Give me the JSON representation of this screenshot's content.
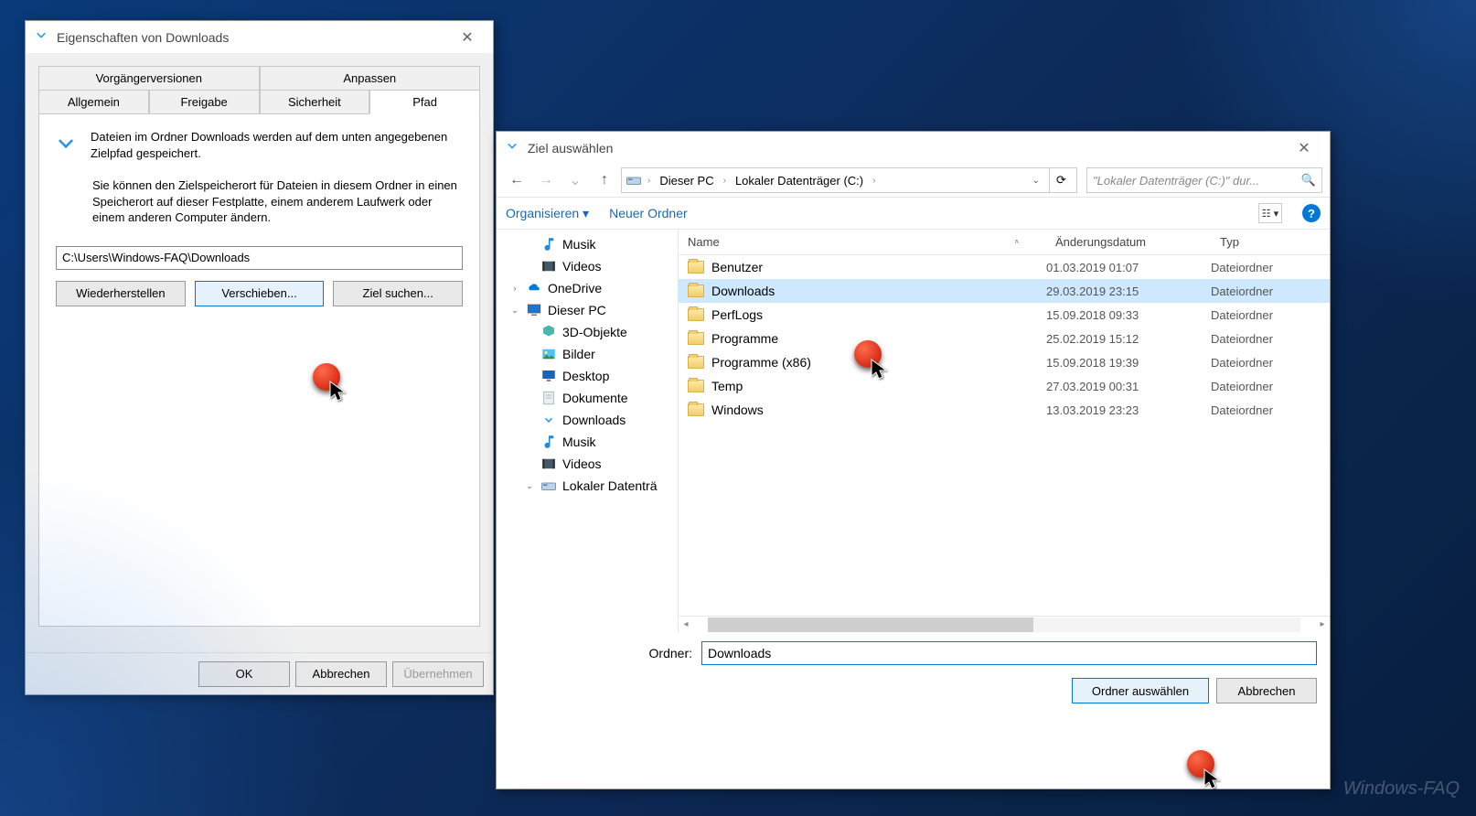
{
  "props": {
    "title": "Eigenschaften von Downloads",
    "tabs_row1": [
      "Vorgängerversionen",
      "Anpassen"
    ],
    "tabs_row2": [
      "Allgemein",
      "Freigabe",
      "Sicherheit",
      "Pfad"
    ],
    "active_tab": "Pfad",
    "info_line": "Dateien im Ordner Downloads werden auf dem unten angegebenen Zielpfad gespeichert.",
    "para": "Sie können den Zielspeicherort für Dateien in diesem Ordner in einen Speicherort auf dieser Festplatte, einem anderem Laufwerk oder einem anderen Computer ändern.",
    "path_value": "C:\\Users\\Windows-FAQ\\Downloads",
    "btn_restore": "Wiederherstellen",
    "btn_move": "Verschieben...",
    "btn_find": "Ziel suchen...",
    "btn_ok": "OK",
    "btn_cancel": "Abbrechen",
    "btn_apply": "Übernehmen"
  },
  "picker": {
    "title": "Ziel auswählen",
    "breadcrumb": [
      "Dieser PC",
      "Lokaler Datenträger (C:)"
    ],
    "search_placeholder": "\"Lokaler Datenträger (C:)\" dur...",
    "cmd_organize": "Organisieren",
    "cmd_newfolder": "Neuer Ordner",
    "tree": [
      {
        "label": "Musik",
        "icon": "music",
        "indent": 1
      },
      {
        "label": "Videos",
        "icon": "video",
        "indent": 1
      },
      {
        "label": "OneDrive",
        "icon": "onedrive",
        "indent": 0,
        "exp": ">"
      },
      {
        "label": "Dieser PC",
        "icon": "pc",
        "indent": 0,
        "exp": "v"
      },
      {
        "label": "3D-Objekte",
        "icon": "3d",
        "indent": 1
      },
      {
        "label": "Bilder",
        "icon": "pictures",
        "indent": 1
      },
      {
        "label": "Desktop",
        "icon": "desktop",
        "indent": 1
      },
      {
        "label": "Dokumente",
        "icon": "docs",
        "indent": 1
      },
      {
        "label": "Downloads",
        "icon": "downloads",
        "indent": 1
      },
      {
        "label": "Musik",
        "icon": "music",
        "indent": 1
      },
      {
        "label": "Videos",
        "icon": "video",
        "indent": 1
      },
      {
        "label": "Lokaler Datenträ",
        "icon": "drive",
        "indent": 1,
        "exp": "v"
      }
    ],
    "columns": {
      "name": "Name",
      "date": "Änderungsdatum",
      "type": "Typ"
    },
    "rows": [
      {
        "name": "Benutzer",
        "date": "01.03.2019 01:07",
        "type": "Dateiordner"
      },
      {
        "name": "Downloads",
        "date": "29.03.2019 23:15",
        "type": "Dateiordner",
        "selected": true
      },
      {
        "name": "PerfLogs",
        "date": "15.09.2018 09:33",
        "type": "Dateiordner"
      },
      {
        "name": "Programme",
        "date": "25.02.2019 15:12",
        "type": "Dateiordner"
      },
      {
        "name": "Programme (x86)",
        "date": "15.09.2018 19:39",
        "type": "Dateiordner"
      },
      {
        "name": "Temp",
        "date": "27.03.2019 00:31",
        "type": "Dateiordner"
      },
      {
        "name": "Windows",
        "date": "13.03.2019 23:23",
        "type": "Dateiordner"
      }
    ],
    "folder_label": "Ordner:",
    "folder_value": "Downloads",
    "btn_select": "Ordner auswählen",
    "btn_cancel": "Abbrechen"
  },
  "watermark": "Windows-FAQ"
}
